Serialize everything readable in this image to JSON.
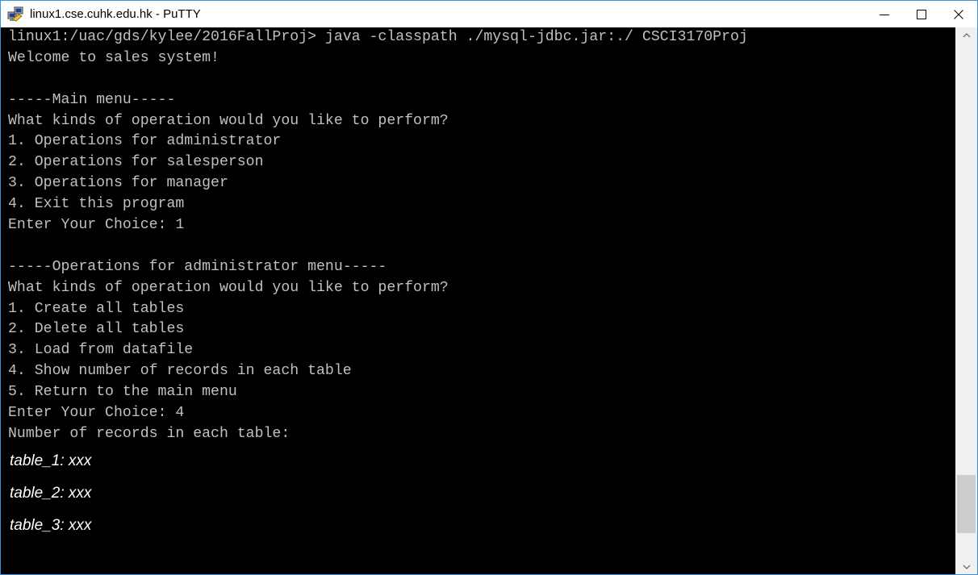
{
  "window": {
    "title": "linux1.cse.cuhk.edu.hk - PuTTY",
    "app_icon": "putty-icon",
    "controls": {
      "minimize_icon": "minimize-icon",
      "maximize_icon": "maximize-icon",
      "close_icon": "close-icon"
    }
  },
  "terminal": {
    "lines": [
      "linux1:/uac/gds/kylee/2016FallProj> java -classpath ./mysql-jdbc.jar:./ CSCI3170Proj",
      "Welcome to sales system!",
      "",
      "-----Main menu-----",
      "What kinds of operation would you like to perform?",
      "1. Operations for administrator",
      "2. Operations for salesperson",
      "3. Operations for manager",
      "4. Exit this program",
      "Enter Your Choice: 1",
      "",
      "-----Operations for administrator menu-----",
      "What kinds of operation would you like to perform?",
      "1. Create all tables",
      "2. Delete all tables",
      "3. Load from datafile",
      "4. Show number of records in each table",
      "5. Return to the main menu",
      "Enter Your Choice: 4",
      "Number of records in each table:"
    ],
    "italic_lines": [
      "table_1: xxx",
      "table_2: xxx",
      "table_3: xxx"
    ]
  },
  "scrollbar": {
    "up_icon": "scroll-up-arrow-icon",
    "down_icon": "scroll-down-arrow-icon",
    "position": 0.88
  },
  "colors": {
    "terminal_bg": "#000000",
    "terminal_fg": "#c0c0c0",
    "highlight_fg": "#ffffff",
    "window_border": "#3c8fd6"
  }
}
